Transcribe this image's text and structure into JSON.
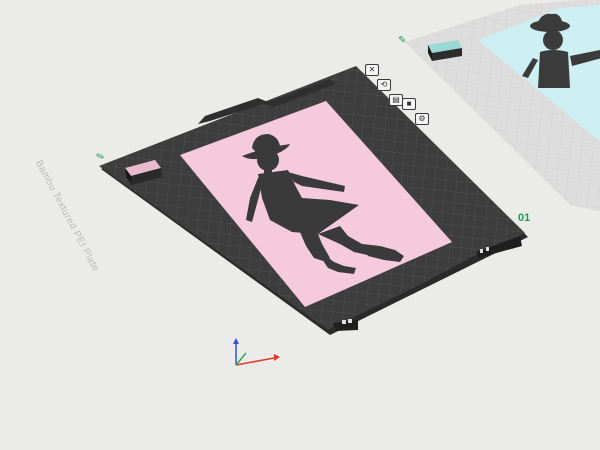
{
  "scene": {
    "plate_label": "Bambu Textured PEI Plate",
    "plate_number": "01",
    "edit_icon_glyph": "✎"
  },
  "toolbar": {
    "buttons": [
      {
        "name": "close-plate-icon",
        "glyph": "✕"
      },
      {
        "name": "auto-orient-icon",
        "glyph": "⟲"
      },
      {
        "name": "arrange-icon",
        "glyph": "▤"
      },
      {
        "name": "lock-plate-icon",
        "glyph": "■"
      },
      {
        "name": "plate-settings-icon",
        "glyph": "⚙"
      }
    ]
  },
  "colors": {
    "background": "#ebebea",
    "plate": "#3d3d3d",
    "grid_line": "#575757",
    "pink_base": "#f5cadd",
    "blue_base": "#cdeef2",
    "silhouette": "#3b3b3b",
    "plate_number": "#1e9e4a",
    "axis_x": "#e03a2a",
    "axis_y": "#2fa84a",
    "axis_z": "#2f55d8"
  }
}
